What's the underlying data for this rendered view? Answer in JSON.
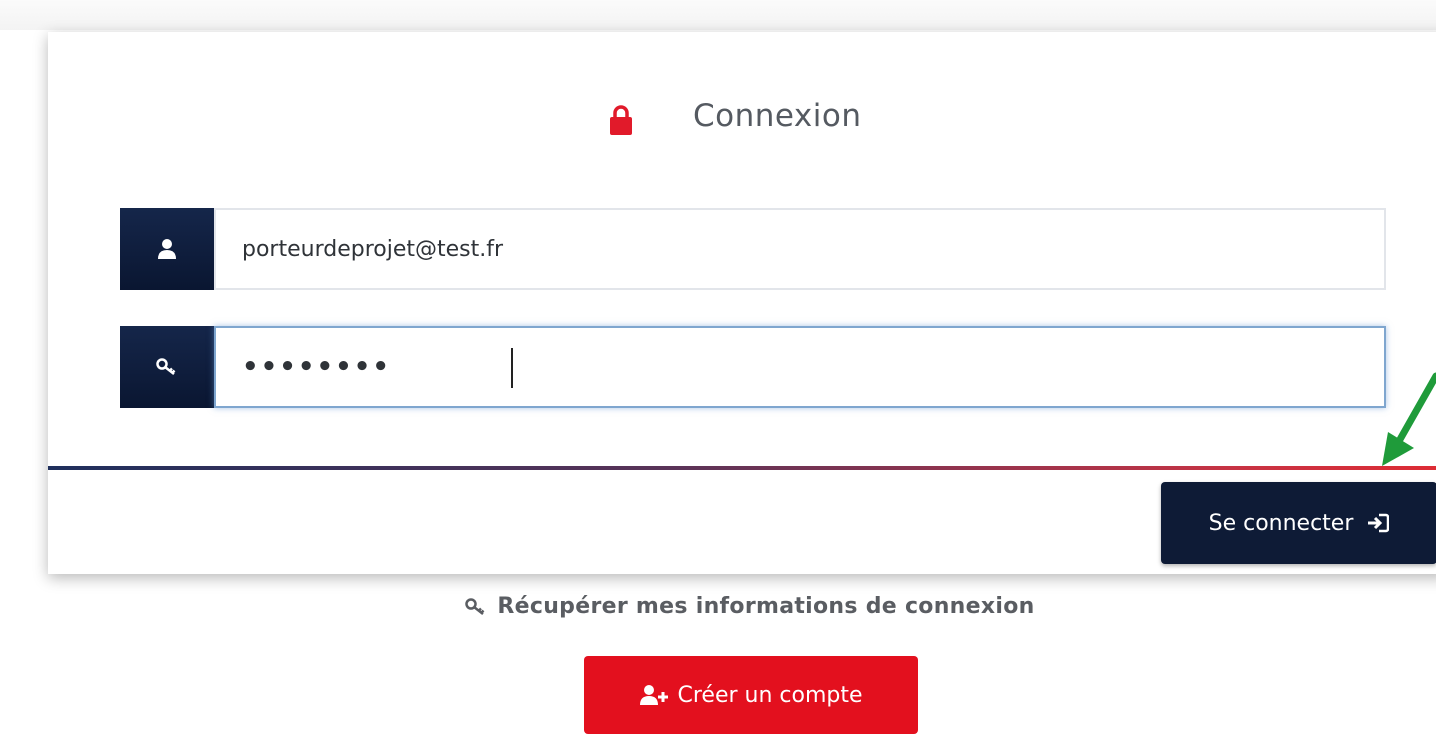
{
  "login_card": {
    "title": "Connexion",
    "email_value": "porteurdeprojet@test.fr",
    "password_value": "••••••••",
    "submit_label": "Se connecter"
  },
  "links": {
    "recover_label": "Récupérer mes informations de connexion",
    "create_account_label": "Créer un compte"
  },
  "icons": {
    "title": "lock-icon",
    "email_addon": "user-icon",
    "password_addon": "key-icon",
    "submit": "sign-in-icon",
    "recover": "key-icon",
    "create_account": "user-plus-icon",
    "annotation": "arrow-icon"
  },
  "colors": {
    "navy": "#0e1b36",
    "accent_red": "#e3101e",
    "lock_red": "#e11a2a",
    "annotation_green": "#1f9b3a"
  }
}
